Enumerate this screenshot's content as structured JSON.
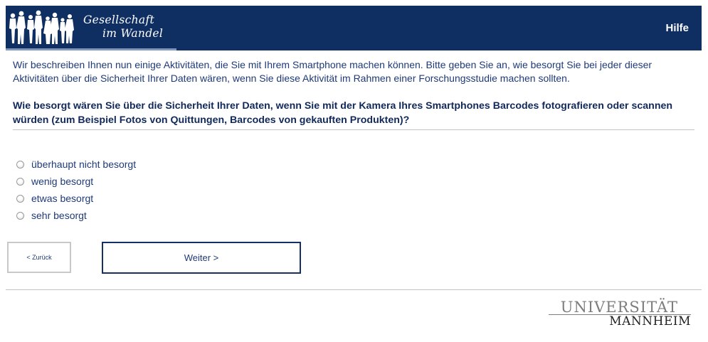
{
  "header": {
    "logo_line1": "Gesellschaft",
    "logo_line2": "im Wandel",
    "help_label": "Hilfe"
  },
  "intro_text": "Wir beschreiben Ihnen nun einige Aktivitäten, die Sie mit Ihrem Smartphone machen können. Bitte geben Sie an, wie besorgt Sie bei jeder dieser Aktivitäten über die Sicherheit Ihrer Daten wären, wenn Sie diese Aktivität im Rahmen einer Forschungsstudie machen sollten.",
  "question_text": "Wie besorgt wären Sie über die Sicherheit Ihrer Daten, wenn Sie mit der Kamera Ihres Smartphones Barcodes fotografieren oder scannen würden (zum Beispiel Fotos von Quittungen, Barcodes von gekauften Produkten)?",
  "options": [
    {
      "label": "überhaupt nicht besorgt",
      "selected": false
    },
    {
      "label": "wenig besorgt",
      "selected": false
    },
    {
      "label": "etwas besorgt",
      "selected": false
    },
    {
      "label": "sehr besorgt",
      "selected": false
    }
  ],
  "nav": {
    "back_label": "< Zurück",
    "next_label": "Weiter >"
  },
  "footer": {
    "uni_line1": "UNIVERSITÄT",
    "uni_line2": "MANNHEIM"
  },
  "colors": {
    "header_bg": "#0f2f63",
    "text": "#1f3a78"
  }
}
